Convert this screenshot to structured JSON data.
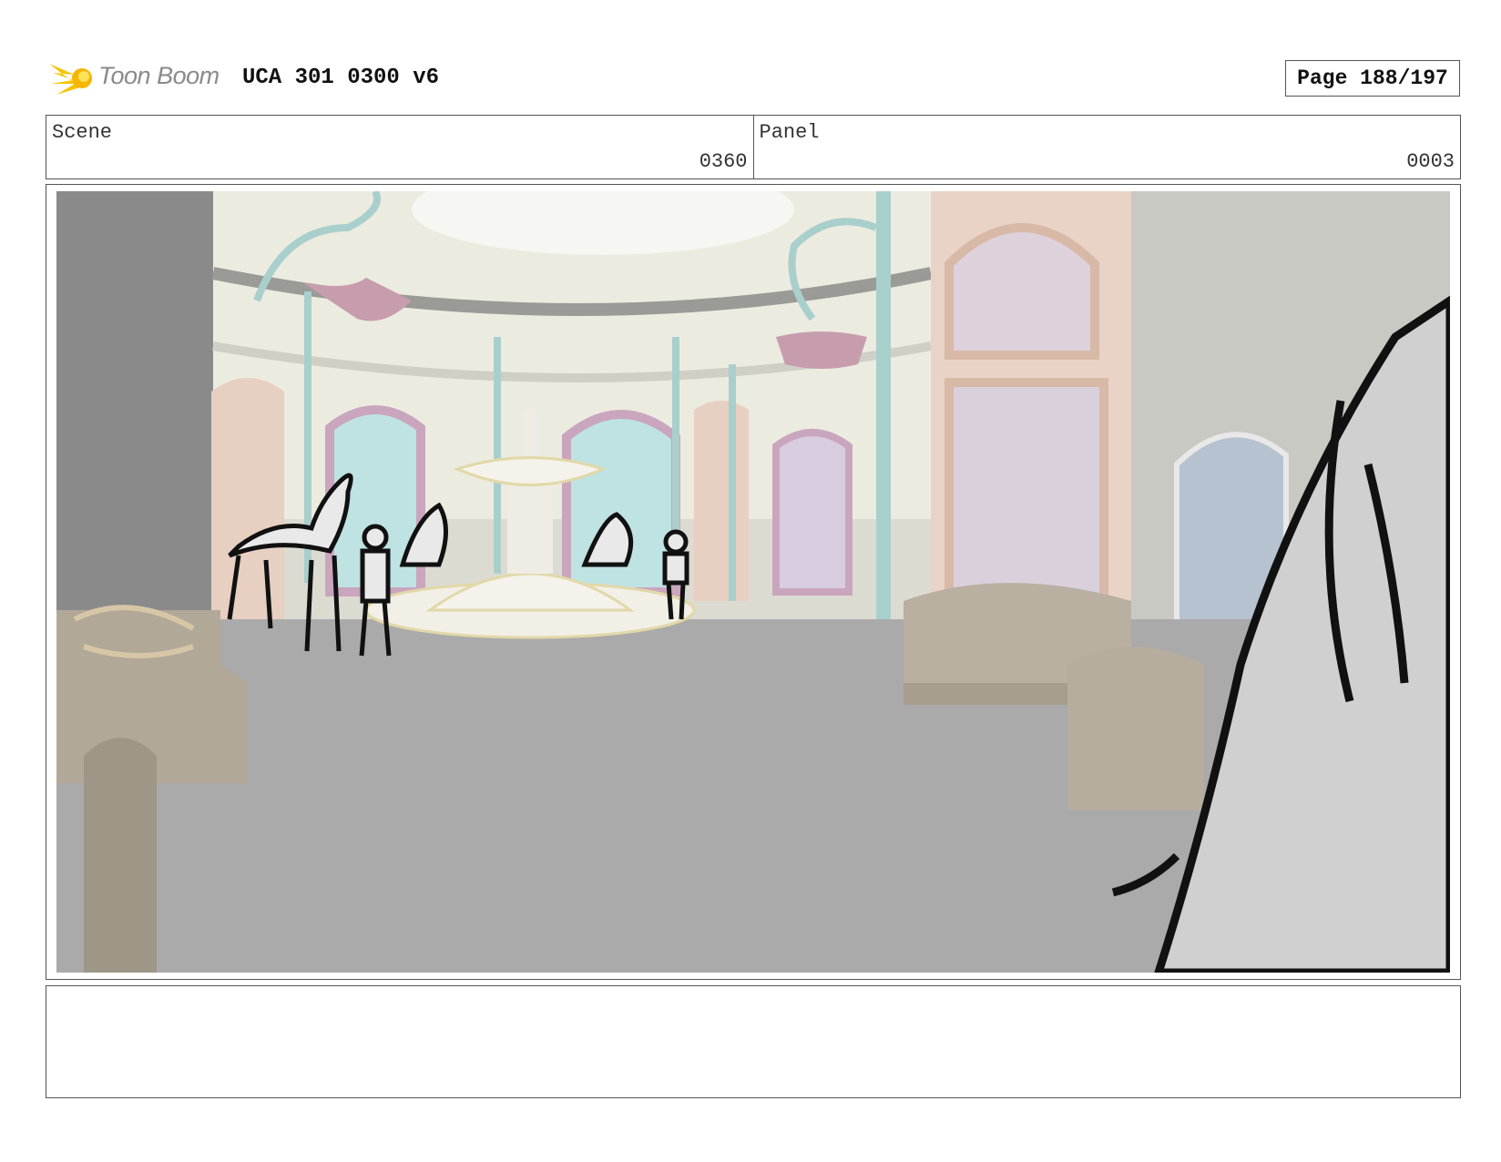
{
  "header": {
    "logo_text": "Toon Boom",
    "title": "UCA 301 0300 v6",
    "page_label": "Page 188/197"
  },
  "info": {
    "scene_label": "Scene",
    "scene_value": "0360",
    "panel_label": "Panel",
    "panel_value": "0003"
  },
  "panel": {
    "description": "",
    "colors": {
      "floor": "#aaaaaa",
      "dome_wall": "#ecebe0",
      "pillar": "#a9cfcc",
      "door_pink": "#e5c9bb",
      "planter": "#c79dad",
      "bench": "#b2a898",
      "character_fill": "#e9e9e9",
      "ink": "#111111"
    }
  },
  "notes": {
    "text": ""
  }
}
